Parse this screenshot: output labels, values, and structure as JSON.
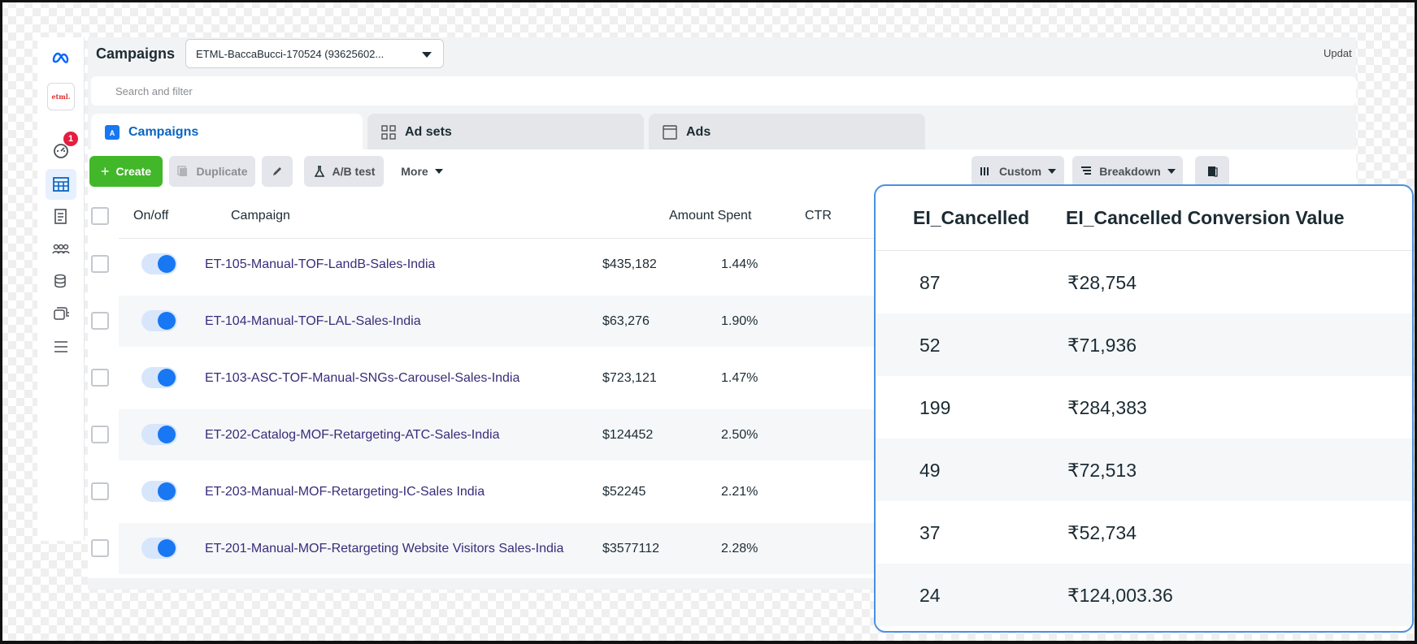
{
  "header": {
    "title": "Campaigns",
    "account_select": "ETML-BaccaBucci-170524 (93625602...",
    "update_text": "Updat"
  },
  "rail": {
    "account_logo_text": "etml.",
    "notification_count": "1"
  },
  "search": {
    "placeholder": "Search and filter"
  },
  "tabs": [
    {
      "label": "Campaigns",
      "icon": "campaigns-icon"
    },
    {
      "label": "Ad sets",
      "icon": "adsets-icon"
    },
    {
      "label": "Ads",
      "icon": "ads-icon"
    }
  ],
  "toolbar": {
    "create": "Create",
    "duplicate": "Duplicate",
    "ab_test": "A/B test",
    "more": "More",
    "columns": "Custom",
    "breakdown": "Breakdown"
  },
  "table": {
    "columns": [
      "On/off",
      "Campaign",
      "Amount Spent",
      "CTR"
    ],
    "rows": [
      {
        "campaign": "ET-105-Manual-TOF-LandB-Sales-India",
        "spent": "$435,182",
        "ctr": "1.44%"
      },
      {
        "campaign": "ET-104-Manual-TOF-LAL-Sales-India",
        "spent": "$63,276",
        "ctr": "1.90%"
      },
      {
        "campaign": "ET-103-ASC-TOF-Manual-SNGs-Carousel-Sales-India",
        "spent": "$723,121",
        "ctr": "1.47%"
      },
      {
        "campaign": "ET-202-Catalog-MOF-Retargeting-ATC-Sales-India",
        "spent": "$124452",
        "ctr": "2.50%"
      },
      {
        "campaign": "ET-203-Manual-MOF-Retargeting-IC-Sales India",
        "spent": "$52245",
        "ctr": "2.21%"
      },
      {
        "campaign": "ET-201-Manual-MOF-Retargeting Website Visitors Sales-India",
        "spent": "$3577112",
        "ctr": "2.28%"
      }
    ]
  },
  "overlay": {
    "columns": [
      "EI_Cancelled",
      "EI_Cancelled Conversion Value"
    ],
    "rows": [
      {
        "count": "87",
        "value": "₹28,754"
      },
      {
        "count": "52",
        "value": "₹71,936"
      },
      {
        "count": "199",
        "value": "₹284,383"
      },
      {
        "count": "49",
        "value": "₹72,513"
      },
      {
        "count": "37",
        "value": "₹52,734"
      },
      {
        "count": "24",
        "value": "₹124,003.36"
      }
    ]
  },
  "colors": {
    "accent": "#1877f2",
    "create": "#42b72a",
    "overlay_border": "#4a90e2"
  }
}
